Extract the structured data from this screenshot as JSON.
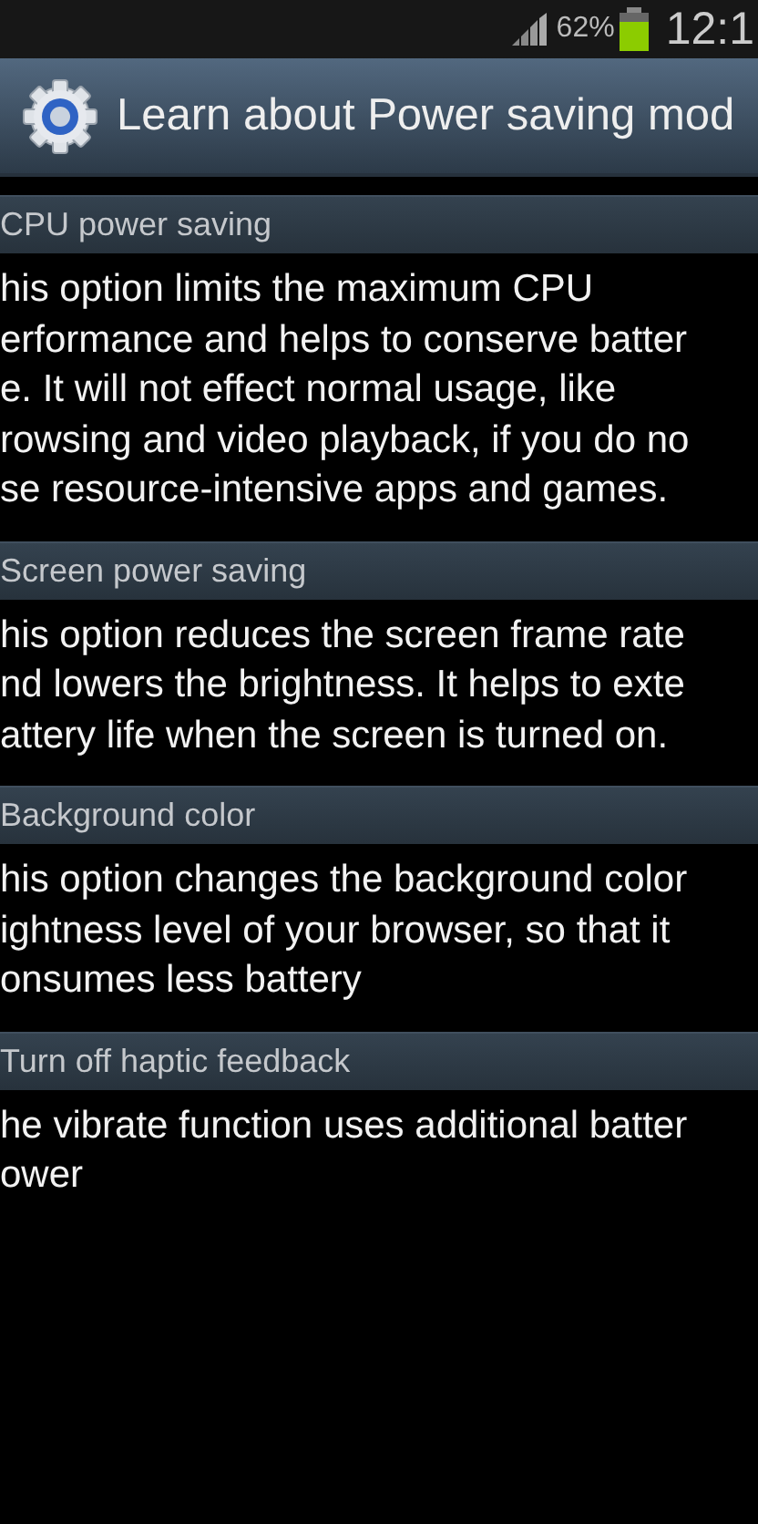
{
  "status_bar": {
    "battery_text": "62%",
    "time": "12:1"
  },
  "title_bar": {
    "title": "Learn about Power saving mod"
  },
  "sections": [
    {
      "heading": "CPU power saving",
      "lines": [
        "his option limits the maximum CPU",
        "erformance and helps to conserve batter",
        "e. It will not effect normal usage, like",
        "rowsing and video playback, if you do no",
        "se resource-intensive apps and games."
      ]
    },
    {
      "heading": "Screen power saving",
      "lines": [
        "his option reduces the screen frame rate",
        "nd lowers the brightness. It helps to exte",
        "attery life when the screen is turned on."
      ]
    },
    {
      "heading": "Background color",
      "lines": [
        "his option changes the background color",
        "ightness level of your browser, so that it",
        "onsumes less battery"
      ]
    },
    {
      "heading": "Turn off haptic feedback",
      "lines": [
        "he vibrate function uses additional batter",
        "ower"
      ]
    }
  ]
}
